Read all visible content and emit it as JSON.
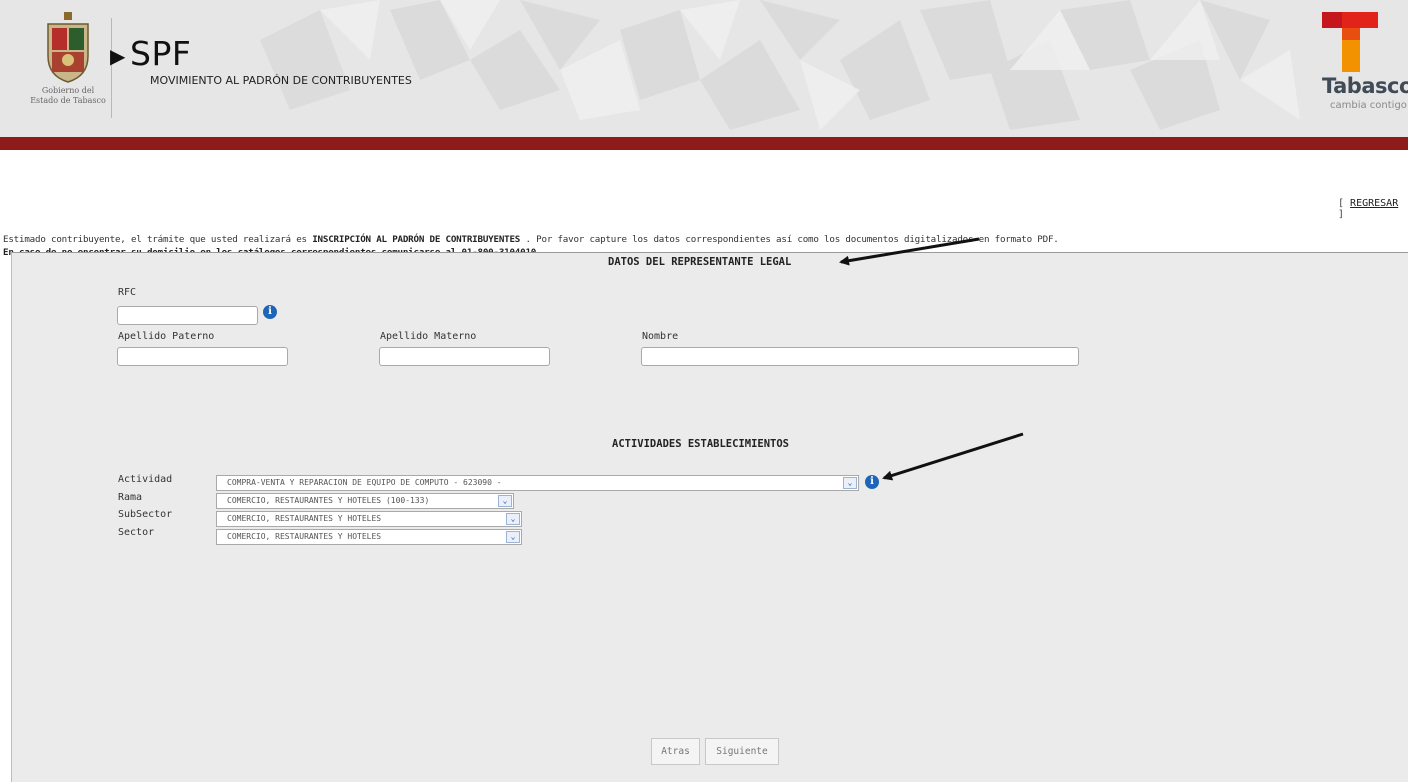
{
  "header": {
    "gov_line1": "Gobierno del",
    "gov_line2": "Estado de Tabasco",
    "app_title": "SPF",
    "app_subtitle": "MOVIMIENTO AL PADRÓN DE CONTRIBUYENTES",
    "brand_name": "Tabasco",
    "brand_slogan": "cambia contigo",
    "bar_color": "#8e1a1b"
  },
  "nav": {
    "regresar": "REGRESAR",
    "open": "[ ",
    "close": " ]"
  },
  "intro": {
    "line1_a": "Estimado contribuyente, el trámite que usted realizará es ",
    "line1_b": "INSCRIPCIÓN AL PADRÓN DE CONTRIBUYENTES",
    "line1_c": " . Por favor capture los datos correspondientes así como los documentos digitalizados en formato PDF.",
    "line2": "En caso de no encontrar su domicilio en los catálogos correspondientes comunicarse al 01-800-3104010"
  },
  "representante": {
    "title": "DATOS DEL REPRESENTANTE LEGAL",
    "rfc_label": "RFC",
    "rfc_value": "",
    "ap_paterno_label": "Apellido Paterno",
    "ap_paterno_value": "",
    "ap_materno_label": "Apellido Materno",
    "ap_materno_value": "",
    "nombre_label": "Nombre",
    "nombre_value": ""
  },
  "actividades": {
    "title": "ACTIVIDADES ESTABLECIMIENTOS",
    "actividad_label": "Actividad",
    "actividad_value": "COMPRA-VENTA Y REPARACION DE EQUIPO DE COMPUTO - 623090 -",
    "rama_label": "Rama",
    "rama_value": "COMERCIO, RESTAURANTES Y HOTELES (100-133)",
    "subsector_label": "SubSector",
    "subsector_value": "COMERCIO, RESTAURANTES Y HOTELES",
    "sector_label": "Sector",
    "sector_value": "COMERCIO, RESTAURANTES Y HOTELES"
  },
  "buttons": {
    "atras": "Atras",
    "siguiente": "Siguiente"
  },
  "icons": {
    "info": "info-icon",
    "dropdown": "chevron-down-icon",
    "arrow": "annotation-arrow-icon"
  },
  "colors": {
    "accent_blue": "#1e64b8",
    "brand_red": "#e2231a",
    "brand_orange": "#f39200"
  }
}
